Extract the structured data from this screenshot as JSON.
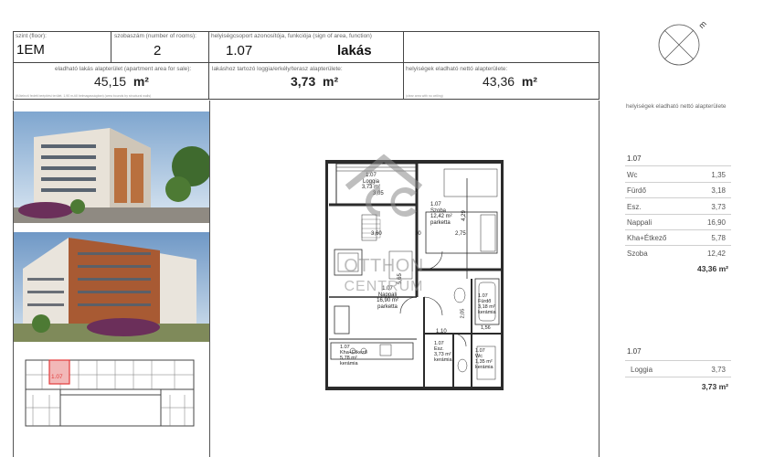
{
  "header": {
    "floor_label": "szint (floor):",
    "floor_value": "1EM",
    "rooms_label": "szobaszám (number of rooms):",
    "rooms_value": "2",
    "id_label": "helyiségcsoport azonosítója, funkciója (sign of area, function)",
    "id_value": "1.07",
    "function_value": "lakás",
    "area_label": "eladható lakás alapterület (apartment area for sale):",
    "area_value": "45,15",
    "area_unit": "m²",
    "loggia_label": "lakáshoz tartozó loggia/erkély/terasz alapterülete:",
    "loggia_value": "3,73",
    "loggia_unit": "m²",
    "net_label": "helyiségek eladható nettó alapterülete:",
    "net_value": "43,36",
    "net_unit": "m²",
    "fine_print_left": "(Kötelező fedett beépítési terület, 1,90 m-től belmagasságban) (area bounds by structural walls)",
    "fine_print_right": "(clear area with no ceiling)"
  },
  "watermark": {
    "logo_letters": "OC",
    "line1": "OTTHON",
    "line2": "CENTRUM"
  },
  "compass": {
    "label": "m"
  },
  "plan": {
    "loggia": {
      "id": "1.07",
      "name": "Loggia",
      "area": "3,73 m²",
      "dim": "3,05"
    },
    "szoba": {
      "id": "1.07",
      "name": "Szoba",
      "area": "12,42 m²",
      "floor": "parketta",
      "dim": "4,29",
      "dim2": "2,75"
    },
    "nappali": {
      "id": "1.07",
      "name": "Nappali",
      "area": "16,90 m²",
      "floor": "parketta",
      "dim": "3,60",
      "dim2": "5,65"
    },
    "furdo": {
      "id": "1.07",
      "name": "Fürdő",
      "area": "3,18 m²",
      "floor": "kerámia",
      "dim": "1,56"
    },
    "kha": {
      "id": "1.07",
      "name": "Kha+Étkező",
      "area": "5,78 m²",
      "floor": "kerámia"
    },
    "esz": {
      "id": "1.07",
      "name": "Esz.",
      "area": "3,73 m²",
      "floor": "kerámia",
      "dim": "1,10"
    },
    "wc": {
      "id": "1.07",
      "name": "Wc",
      "area": "1,35 m²",
      "floor": "kerámia"
    },
    "misc_dim": "10",
    "misc_dim2": "2,05"
  },
  "right_panel": {
    "title": "helyiségek eladható nettó alapterülete",
    "group1_id": "1.07",
    "rooms": [
      {
        "name": "Wc",
        "area": "1,35"
      },
      {
        "name": "Fürdő",
        "area": "3,18"
      },
      {
        "name": "Esz.",
        "area": "3,73"
      },
      {
        "name": "Nappali",
        "area": "16,90"
      },
      {
        "name": "Kha+Étkező",
        "area": "5,78"
      },
      {
        "name": "Szoba",
        "area": "12,42"
      }
    ],
    "total1": "43,36 m²",
    "group2_id": "1.07",
    "loggia_rows": [
      {
        "name": "Loggia",
        "area": "3,73"
      }
    ],
    "total2": "3,73 m²"
  },
  "key_plan": {
    "highlight_label": "1.07"
  },
  "colors": {
    "highlight": "#e23b3b",
    "wall": "#2b2b2b",
    "watermark": "#8a8a8a"
  }
}
